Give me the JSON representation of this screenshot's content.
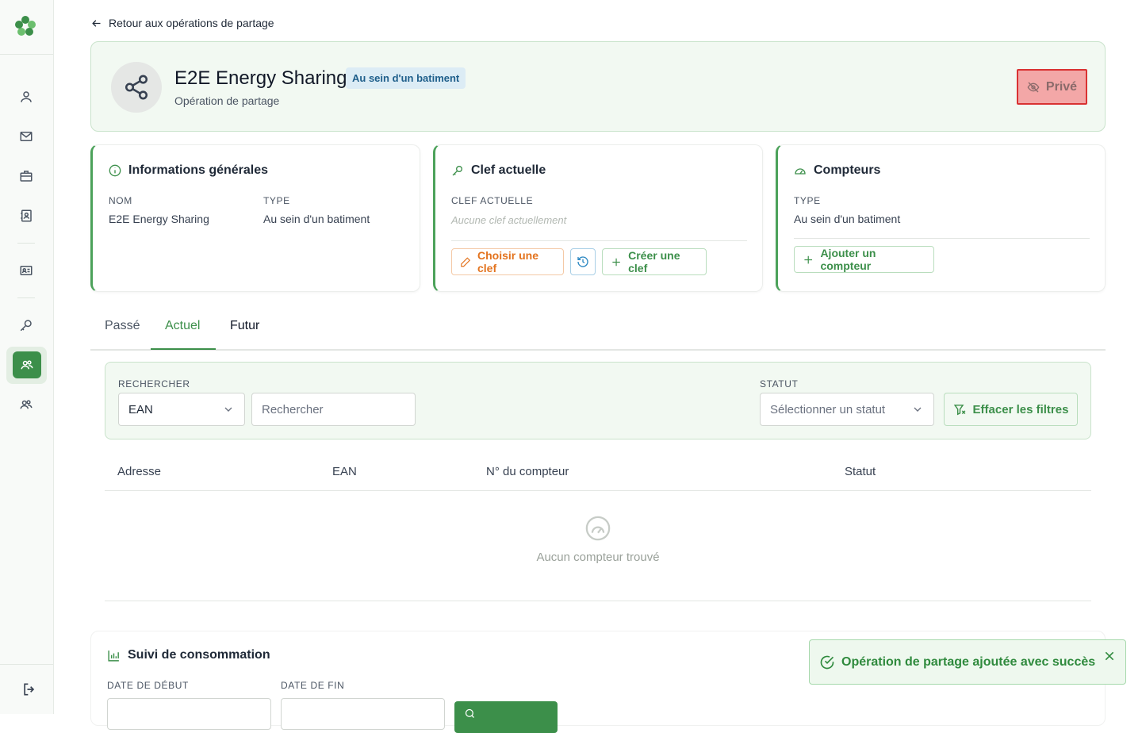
{
  "nav": {
    "back_label": "Retour aux opérations de partage"
  },
  "hero": {
    "title": "E2E Energy Sharing",
    "badge": "Au sein d'un batiment",
    "subtitle": "Opération de partage",
    "private_label": "Privé",
    "colors": {
      "accent": "#3c8f4a",
      "private_bg": "#f3a7a7",
      "private_border": "#d93232"
    }
  },
  "info_card": {
    "title": "Informations générales",
    "name_label": "NOM",
    "name_value": "E2E Energy Sharing",
    "type_label": "TYPE",
    "type_value": "Au sein d'un batiment"
  },
  "key_card": {
    "title": "Clef actuelle",
    "label": "CLEF ACTUELLE",
    "placeholder": "Aucune clef actuellement",
    "choose_label": "Choisir une clef",
    "create_label": "Créer une clef"
  },
  "meter_card": {
    "title": "Compteurs",
    "type_label": "TYPE",
    "type_value": "Au sein d'un batiment",
    "add_label": "Ajouter un compteur"
  },
  "tabs": [
    {
      "label": "Passé"
    },
    {
      "label": "Actuel"
    },
    {
      "label": "Futur"
    }
  ],
  "filters": {
    "search_label": "RECHERCHER",
    "search_field_value": "EAN",
    "search_placeholder": "Rechercher",
    "status_label": "STATUT",
    "status_placeholder": "Sélectionner un statut",
    "clear_label": "Effacer les filtres"
  },
  "table": {
    "columns": [
      "Adresse",
      "EAN",
      "N° du compteur",
      "Statut"
    ],
    "empty_message": "Aucun compteur trouvé"
  },
  "consumption": {
    "title": "Suivi de consommation",
    "start_label": "DATE DE DÉBUT",
    "end_label": "DATE DE FIN"
  },
  "toast": {
    "message": "Opération de partage ajoutée avec succès"
  }
}
